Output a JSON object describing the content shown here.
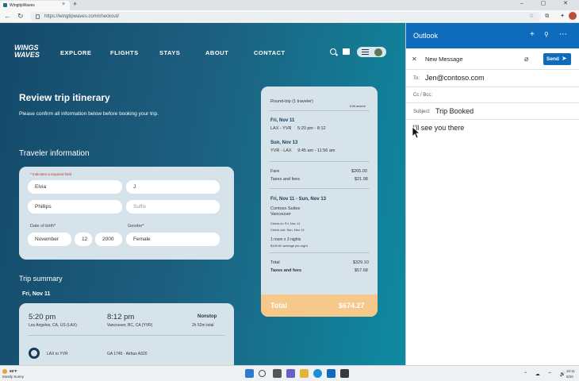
{
  "browser": {
    "tab_title": "WingtipWaves",
    "tab_close": "×",
    "new_tab": "+",
    "url": "https://wingtipwaves.com/checkout/",
    "window_controls": "–  ▢  ✕"
  },
  "site": {
    "logo": "WINGS\nWAVES",
    "nav": [
      "EXPLORE",
      "FLIGHTS",
      "STAYS",
      "ABOUT",
      "CONTACT"
    ]
  },
  "review": {
    "title": "Review trip itinerary",
    "subtitle": "Please confirm all information below before booking your trip."
  },
  "traveler": {
    "heading": "Traveler information",
    "required_note": "* Indicates a required field",
    "first_name": "Elvia",
    "middle_initial": "J",
    "last_name": "Phillips",
    "suffix_placeholder": "Suffix",
    "dob_label": "Date of birth*",
    "gender_label": "Gender*",
    "dob_month": "November",
    "dob_day": "12",
    "dob_year": "2000",
    "gender": "Female"
  },
  "trip_summary": {
    "heading": "Trip summary",
    "date": "Fri, Nov 11",
    "depart_time": "5:20 pm",
    "depart_place": "Los Angeles, CA, US (LAX)",
    "arrive_time": "8:12 pm",
    "arrive_place": "Vancouver, BC, CA (YVR)",
    "stops": "Nonstop",
    "duration": "2h 52m total",
    "route": "LAX to YVR",
    "flight": "GA 1745 · Airbus A320"
  },
  "summary_card": {
    "header": "Round-trip (1 traveler)",
    "edit": "Edit search",
    "out_date": "Fri, Nov 11",
    "out_detail": "LAX - YVR     5:20 pm - 8:12",
    "ret_date": "Sun, Nov 13",
    "ret_detail": "YVR - LAX     9:45 am - 11:56 am",
    "fare_label": "Fare",
    "fare_value": "$265.00",
    "taxes_label": "Taxes and fees",
    "taxes_value": "$21.98",
    "hotel_dates": "Fri, Nov 11 - Sun, Nov 13",
    "hotel_name": "Contoso Suites",
    "hotel_city": "Vancouver",
    "check_in": "Check-in: Fri, Nov 11",
    "check_out": "Check-out: Sun, Nov 13",
    "room": "1 room x 3 nights",
    "avg_price": "$109.60 average per night",
    "total_label": "Total",
    "total_value": "$329.10",
    "hotel_taxes_label": "Taxes and fees",
    "hotel_taxes_value": "$57.68",
    "grand_total_label": "Total",
    "grand_total_value": "$674.27"
  },
  "outlook": {
    "title": "Outlook",
    "new_message": "New Message",
    "send_label": "Send",
    "to_label": "To:",
    "to_value": "Jen@contoso.com",
    "cc_label": "Cc / Bcc:",
    "subject_label": "Subject:",
    "subject_value": "Trip Booked",
    "body": "I'll see you there"
  },
  "taskbar": {
    "weather_temp": "68°F",
    "weather_desc": "Mostly Sunny",
    "time": "10:11",
    "date": "5/20"
  },
  "colors": {
    "accent": "#0f6cbd",
    "total_bar": "#f6c88a",
    "card": "#d7e3ea"
  }
}
